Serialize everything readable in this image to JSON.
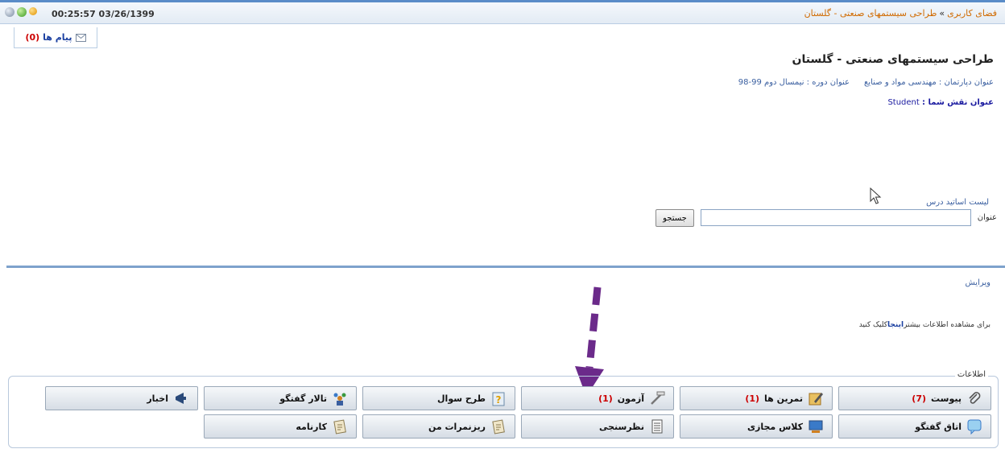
{
  "topbar": {
    "breadcrumb_root": "فضای کاربری",
    "breadcrumb_sep": "»",
    "breadcrumb_current": "طراحی سیستمهای صنعتی - گلستان",
    "datetime": "00:25:57 03/26/1399"
  },
  "messages": {
    "label": "پیام ها",
    "count": "(0)"
  },
  "course": {
    "title": "طراحی سیستمهای صنعتی - گلستان",
    "department": "عنوان دپارتمان : مهندسی مواد و صنایع",
    "term": "عنوان دوره : نیمسال دوم 99-98",
    "role_label": "عنوان نقش شما :",
    "role_value": "Student"
  },
  "teachers": {
    "title": "لیست اساتید درس",
    "search_label": "عنوان",
    "search_value": "",
    "search_button": "جستجو"
  },
  "edit_link": "ویرایش",
  "more_info": {
    "before": "برای مشاهده اطلاعات بیشتر",
    "link": "اینجا",
    "after": "کلیک کنید"
  },
  "info_panel": {
    "legend": "اطلاعات",
    "buttons": [
      {
        "label": "پیوست",
        "count": "(7)",
        "icon": "paperclip-icon"
      },
      {
        "label": "تمرین ها",
        "count": "(1)",
        "icon": "pencil-icon"
      },
      {
        "label": "آزمون",
        "count": "(1)",
        "icon": "ruler-pencil-icon"
      },
      {
        "label": "طرح سوال",
        "count": "",
        "icon": "question-clipboard-icon"
      },
      {
        "label": "تالار گفتگو",
        "count": "",
        "icon": "people-icon"
      },
      {
        "label": "اخبار",
        "count": "",
        "icon": "megaphone-icon"
      },
      {
        "label": "اتاق گفتگو",
        "count": "",
        "icon": "chat-room-icon"
      },
      {
        "label": "کلاس مجازی",
        "count": "",
        "icon": "virtual-class-icon"
      },
      {
        "label": "نظرسنجی",
        "count": "",
        "icon": "survey-icon"
      },
      {
        "label": "ریزنمرات من",
        "count": "",
        "icon": "grades-icon"
      },
      {
        "label": "کارنامه",
        "count": "",
        "icon": "report-card-icon"
      }
    ]
  },
  "colors": {
    "accent": "#5a8cc8",
    "link": "#3a5fa0",
    "breadcrumb": "#d06a00",
    "count": "#cc0000",
    "arrow": "#6b2a8a"
  }
}
